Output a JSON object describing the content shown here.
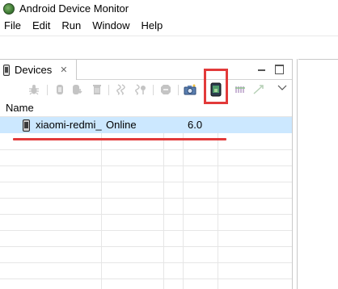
{
  "window": {
    "title": "Android Device Monitor"
  },
  "menu": {
    "items": [
      "File",
      "Edit",
      "Run",
      "Window",
      "Help"
    ]
  },
  "devices_view": {
    "tab_label": "Devices",
    "column_header": "Name",
    "rows": [
      {
        "name": "xiaomi-redmi_",
        "state": "Online",
        "version": "6.0"
      }
    ]
  },
  "toolbar": {
    "icons": [
      "debug-bug-icon",
      "update-heap-icon",
      "dump-hprof-icon",
      "cause-gc-icon",
      "update-threads-icon",
      "start-method-profiling-icon",
      "stop-process-icon",
      "screen-capture-icon",
      "dump-view-hierarchy-icon",
      "systrace-icon",
      "opengl-trace-icon",
      "view-menu-icon"
    ],
    "highlighted": "dump-view-hierarchy-icon"
  },
  "annotations": {
    "highlight_color": "#e23a3a"
  },
  "colors": {
    "selection": "#cce8ff"
  }
}
